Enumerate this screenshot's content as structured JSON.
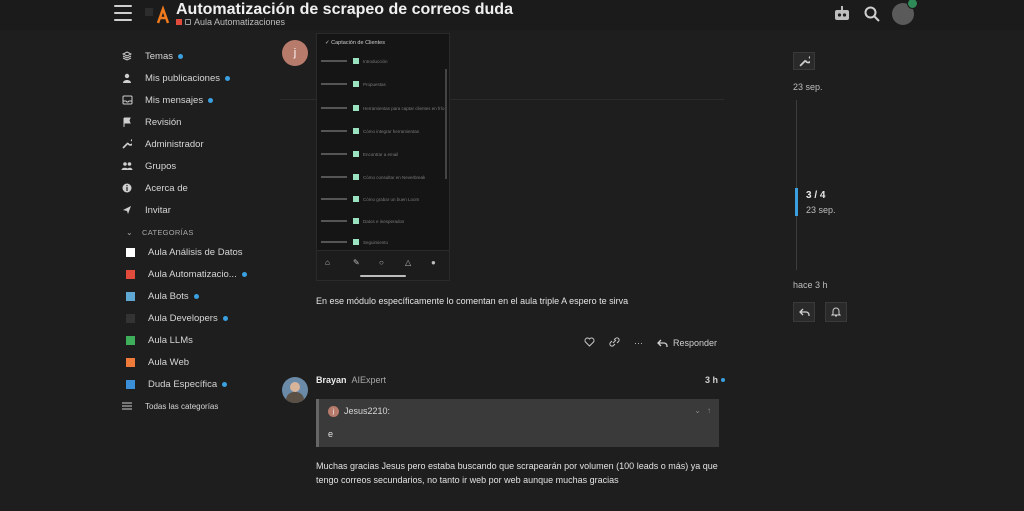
{
  "header": {
    "title": "Automatización de scrapeo de correos duda",
    "category": "Aula Automatizaciones",
    "category_color": "#e04b3c",
    "icons": [
      "menu-icon",
      "robot-icon",
      "search-icon",
      "avatar"
    ]
  },
  "sidebar": {
    "items": [
      {
        "label": "Temas",
        "icon": "layers-icon",
        "unread": true
      },
      {
        "label": "Mis publicaciones",
        "icon": "user-icon",
        "unread": true
      },
      {
        "label": "Mis mensajes",
        "icon": "inbox-icon",
        "unread": true
      },
      {
        "label": "Revisión",
        "icon": "flag-icon",
        "unread": false
      },
      {
        "label": "Administrador",
        "icon": "wrench-icon",
        "unread": false
      },
      {
        "label": "Grupos",
        "icon": "users-icon",
        "unread": false
      },
      {
        "label": "Acerca de",
        "icon": "info-icon",
        "unread": false
      },
      {
        "label": "Invitar",
        "icon": "send-icon",
        "unread": false
      }
    ],
    "categories_heading": "CATEGORÍAS",
    "categories": [
      {
        "label": "Aula Análisis de Datos",
        "color": "#ffffff",
        "unread": false
      },
      {
        "label": "Aula Automatizacio...",
        "color": "#e04b3c",
        "unread": true
      },
      {
        "label": "Aula Bots",
        "color": "#5fa8d3",
        "unread": true
      },
      {
        "label": "Aula Developers",
        "color": "#333333",
        "unread": true
      },
      {
        "label": "Aula LLMs",
        "color": "#3fae5b",
        "unread": false
      },
      {
        "label": "Aula Web",
        "color": "#f07a3a",
        "unread": false
      },
      {
        "label": "Duda Específica",
        "color": "#3a8fd6",
        "unread": true
      }
    ],
    "all_categories": "Todas las categorías"
  },
  "post1": {
    "avatar_letter": "j",
    "avatar_color": "#b77b6b",
    "screenshot": {
      "heading": "✓ Captación de Clientes",
      "rows": [
        "Introducción",
        "Propuestas",
        "Herramientas para captar clientes en frío",
        "Cómo integrar herramientas",
        "Encontrar a email",
        "Cómo consultar en Neverbreak",
        "Cómo grabar un buen Loom",
        "Datos e inesperados",
        "Seguimiento"
      ]
    },
    "text": "En ese módulo específicamente lo comentan en el aula triple A espero te sirva",
    "reply_label": "Responder"
  },
  "post2": {
    "username": "Brayan",
    "title": "AIExpert",
    "time": "3 h",
    "quote": {
      "author_letter": "j",
      "author": "Jesus2210:",
      "text": "e"
    },
    "text": "Muchas gracias Jesus pero estaba buscando que scrapearán por volumen (100 leads o más) ya que tengo correos secundarios, no tanto ir web por web aunque muchas gracias"
  },
  "timeline": {
    "start_date": "23 sep.",
    "position": "3 / 4",
    "current_date": "23 sep.",
    "ago": "hace 3 h",
    "progress": 0.55
  },
  "colors": {
    "accent": "#3aa0e0",
    "bg": "#1e1e1e"
  }
}
